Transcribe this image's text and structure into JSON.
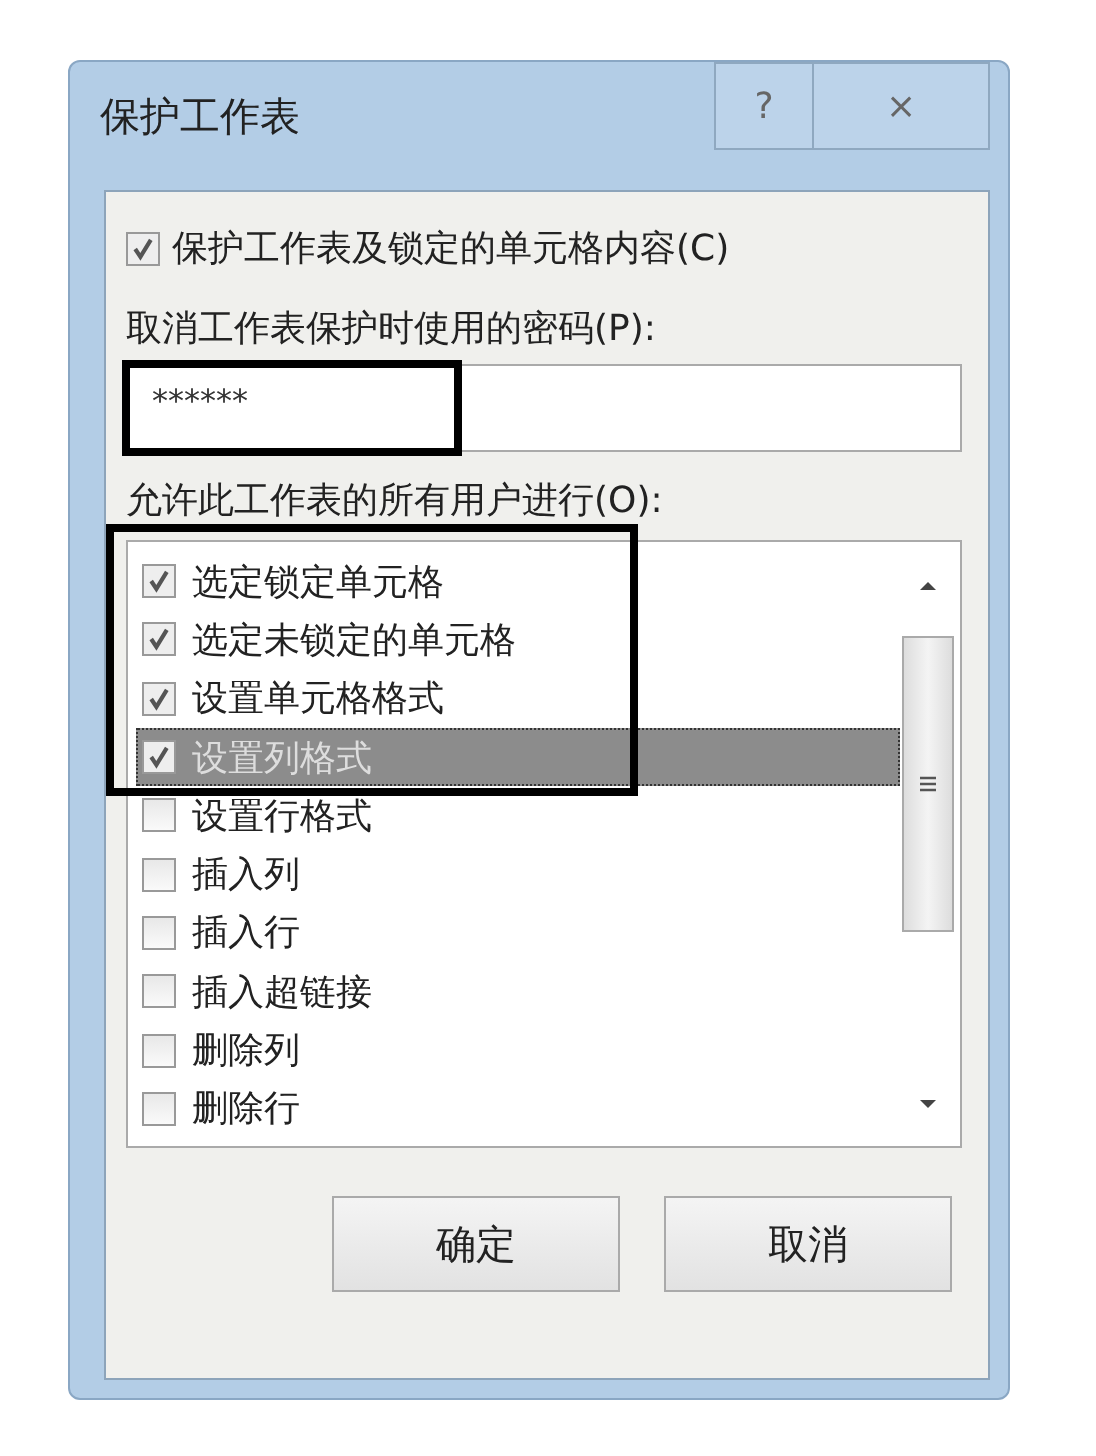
{
  "window": {
    "title": "保护工作表",
    "help_button": "?",
    "close_button": "×"
  },
  "protect_checkbox": {
    "label": "保护工作表及锁定的单元格内容(C)",
    "checked": true
  },
  "password": {
    "label": "取消工作表保护时使用的密码(P):",
    "value": "******"
  },
  "permissions": {
    "label": "允许此工作表的所有用户进行(O):",
    "items": [
      {
        "label": "选定锁定单元格",
        "checked": true,
        "selected": false
      },
      {
        "label": "选定未锁定的单元格",
        "checked": true,
        "selected": false
      },
      {
        "label": "设置单元格格式",
        "checked": true,
        "selected": false
      },
      {
        "label": "设置列格式",
        "checked": true,
        "selected": true
      },
      {
        "label": "设置行格式",
        "checked": false,
        "selected": false
      },
      {
        "label": "插入列",
        "checked": false,
        "selected": false
      },
      {
        "label": "插入行",
        "checked": false,
        "selected": false
      },
      {
        "label": "插入超链接",
        "checked": false,
        "selected": false
      },
      {
        "label": "删除列",
        "checked": false,
        "selected": false
      },
      {
        "label": "删除行",
        "checked": false,
        "selected": false
      }
    ]
  },
  "buttons": [
    "确定",
    "取消"
  ]
}
